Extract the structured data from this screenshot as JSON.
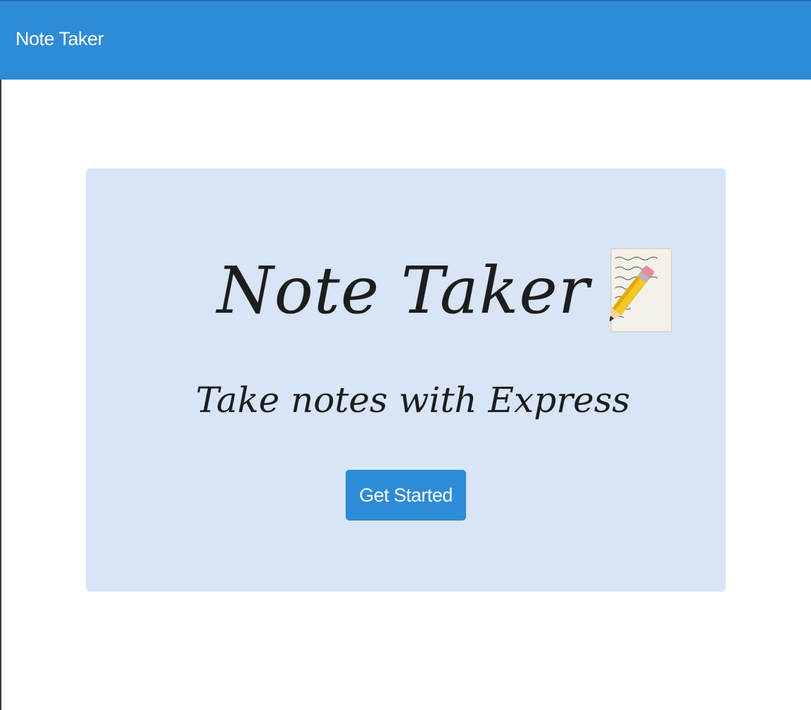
{
  "navbar": {
    "brand": "Note Taker",
    "background_color": "#2e8bd6"
  },
  "hero": {
    "title": "Note Taker",
    "title_icon": "memo-icon",
    "subtitle": "Take notes with Express",
    "cta_label": "Get Started",
    "background_color": "#d7e5f7",
    "cta_color": "#2e8bd6"
  }
}
